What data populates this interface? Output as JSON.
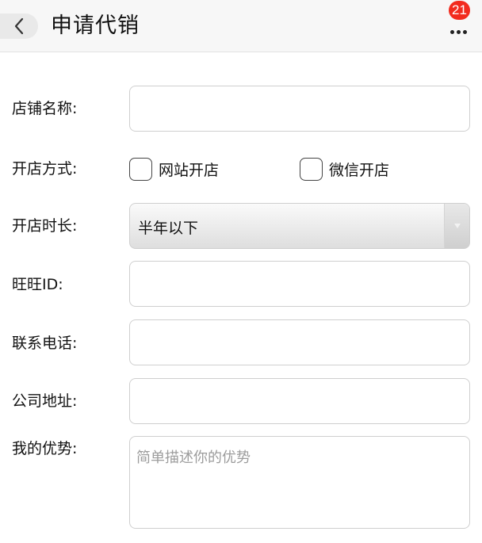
{
  "header": {
    "title": "申请代销",
    "badge_count": "21"
  },
  "form": {
    "shop_name_label": "店铺名称:",
    "shop_name_value": "",
    "open_method_label": "开店方式:",
    "open_method_options": [
      {
        "label": "网站开店",
        "checked": false
      },
      {
        "label": "微信开店",
        "checked": false
      }
    ],
    "duration_label": "开店时长:",
    "duration_selected": "半年以下",
    "wangwang_label": "旺旺ID:",
    "wangwang_value": "",
    "phone_label": "联系电话:",
    "phone_value": "",
    "address_label": "公司地址:",
    "address_value": "",
    "advantage_label": "我的优势:",
    "advantage_placeholder": "简单描述你的优势"
  }
}
